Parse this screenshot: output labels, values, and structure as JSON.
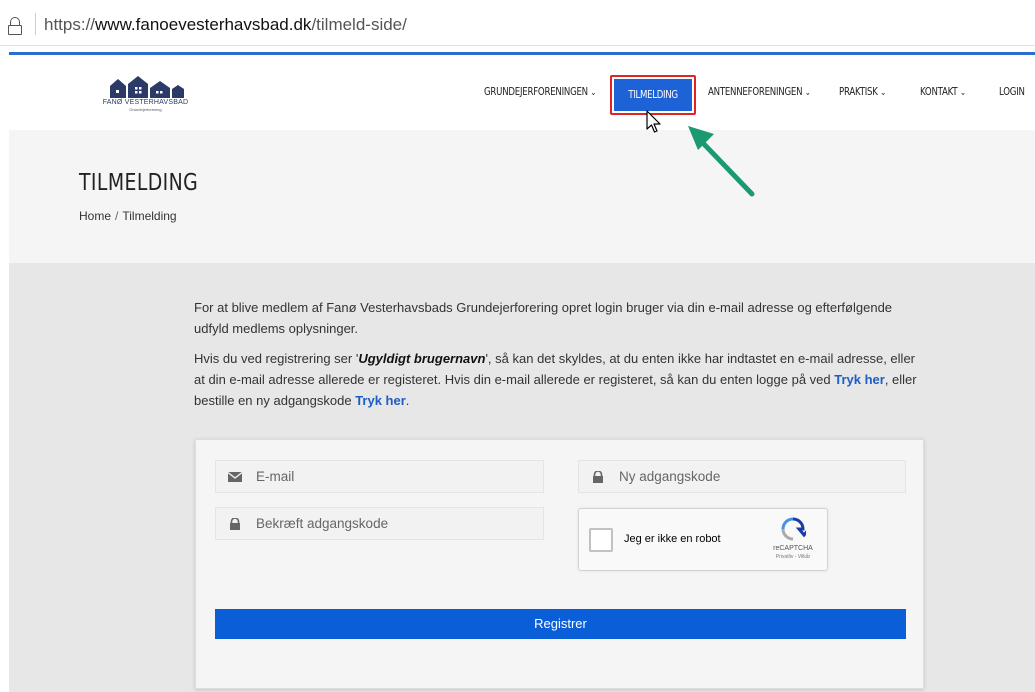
{
  "browser": {
    "url_prefix": "https://",
    "url_domain": "www.fanoevesterhavsbad.dk",
    "url_path": "/tilmeld-side/"
  },
  "header": {
    "logo_text": "FANØ VESTERHAVSBAD",
    "logo_subtext": "Grundejerforening",
    "nav": {
      "grundejer": "GRUNDEJERFORENINGEN",
      "tilmelding": "TILMELDING",
      "antenne": "ANTENNEFORENINGEN",
      "praktisk": "PRAKTISK",
      "kontakt": "KONTAKT",
      "login": "LOGIN"
    },
    "chevron": "⌄"
  },
  "page": {
    "title": "TILMELDING",
    "breadcrumb_home": "Home",
    "breadcrumb_sep": "/",
    "breadcrumb_current": "Tilmelding"
  },
  "intro": {
    "p1": "For at blive medlem af Fanø Vesterhavsbads Grundejerforering opret login bruger via din e-mail adresse og efterfølgende udfyld medlems oplysninger.",
    "p2_a": "Hvis du ved registrering ser '",
    "p2_em": "Ugyldigt brugernavn",
    "p2_b": "', så kan det skyldes, at du enten ikke har indtastet en e-mail adresse, eller at din e-mail adresse allerede er registeret. Hvis din e-mail allerede er registeret, så kan du enten logge på ved ",
    "p2_link1": "Tryk her",
    "p2_c": ", eller bestille en ny adgangskode ",
    "p2_link2": "Tryk her",
    "p2_d": "."
  },
  "form": {
    "email_placeholder": "E-mail",
    "password_placeholder": "Ny adgangskode",
    "confirm_placeholder": "Bekræft adgangskode",
    "recaptcha_label": "Jeg er ikke en robot",
    "recaptcha_brand": "reCAPTCHA",
    "recaptcha_terms": "Privatliv - Vilkår",
    "register_label": "Registrer"
  },
  "colors": {
    "accent": "#1d62d6",
    "highlight": "#e02424",
    "arrow": "#1a9a73"
  }
}
